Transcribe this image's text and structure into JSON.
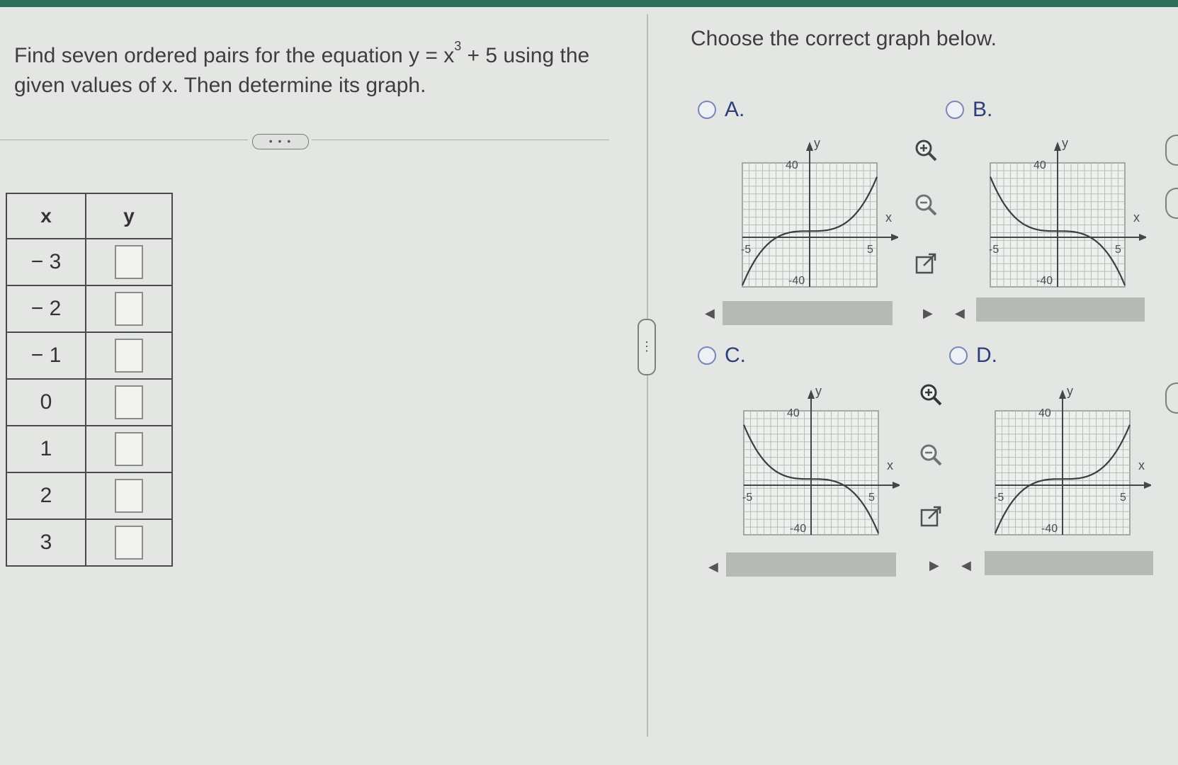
{
  "question": {
    "lead": "Find seven ordered pairs for the equation y = x",
    "exponent": "3",
    "tail": " + 5 using the given values of x. Then determine its graph."
  },
  "expand_button": "• • •",
  "table": {
    "x_header": "x",
    "y_header": "y",
    "rows": [
      {
        "x": "− 3",
        "y": ""
      },
      {
        "x": "− 2",
        "y": ""
      },
      {
        "x": "− 1",
        "y": ""
      },
      {
        "x": "0",
        "y": ""
      },
      {
        "x": "1",
        "y": ""
      },
      {
        "x": "2",
        "y": ""
      },
      {
        "x": "3",
        "y": ""
      }
    ]
  },
  "right_prompt": "Choose the correct graph below.",
  "options": [
    {
      "letter": "A.",
      "shape": "increasing-cubic"
    },
    {
      "letter": "B.",
      "shape": "decreasing-cubic"
    },
    {
      "letter": "C.",
      "shape": "decreasing-cubic"
    },
    {
      "letter": "D.",
      "shape": "increasing-cubic"
    }
  ],
  "axis_labels": {
    "y": "y",
    "x": "x",
    "y_max": "40",
    "y_min": "-40",
    "x_min": "-5",
    "x_max": "5"
  },
  "icons": {
    "zoom_in": "zoom-in-icon",
    "zoom_out": "zoom-out-icon",
    "popout": "popout-icon"
  },
  "colors": {
    "topbar": "#2f6f5a",
    "choice_text": "#2d3e7a"
  }
}
